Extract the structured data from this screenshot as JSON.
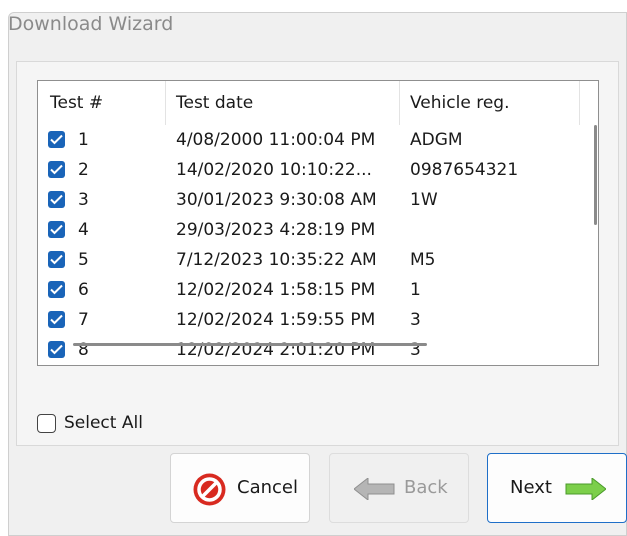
{
  "window": {
    "title": "Download Wizard"
  },
  "list": {
    "columns": [
      "Test #",
      "Test date",
      "Vehicle reg."
    ],
    "rows": [
      {
        "num": "1",
        "date": "4/08/2000 11:00:04 PM",
        "reg": "ADGM",
        "checked": true
      },
      {
        "num": "2",
        "date": "14/02/2020 10:10:22...",
        "reg": "0987654321",
        "checked": true
      },
      {
        "num": "3",
        "date": "30/01/2023 9:30:08 AM",
        "reg": "1W",
        "checked": true
      },
      {
        "num": "4",
        "date": "29/03/2023 4:28:19 PM",
        "reg": "",
        "checked": true
      },
      {
        "num": "5",
        "date": "7/12/2023 10:35:22 AM",
        "reg": "M5",
        "checked": true
      },
      {
        "num": "6",
        "date": "12/02/2024 1:58:15 PM",
        "reg": "1",
        "checked": true
      },
      {
        "num": "7",
        "date": "12/02/2024 1:59:55 PM",
        "reg": "3",
        "checked": true
      },
      {
        "num": "8",
        "date": "12/02/2024 2:01:20 PM",
        "reg": "3",
        "checked": true
      }
    ]
  },
  "select_all": {
    "label": "Select All",
    "checked": false
  },
  "buttons": {
    "cancel": "Cancel",
    "back": "Back",
    "next": "Next"
  },
  "colors": {
    "checkbox_fill": "#1a64b8",
    "cancel_icon": "#d82a20",
    "next_arrow": "#7ccf4a"
  }
}
